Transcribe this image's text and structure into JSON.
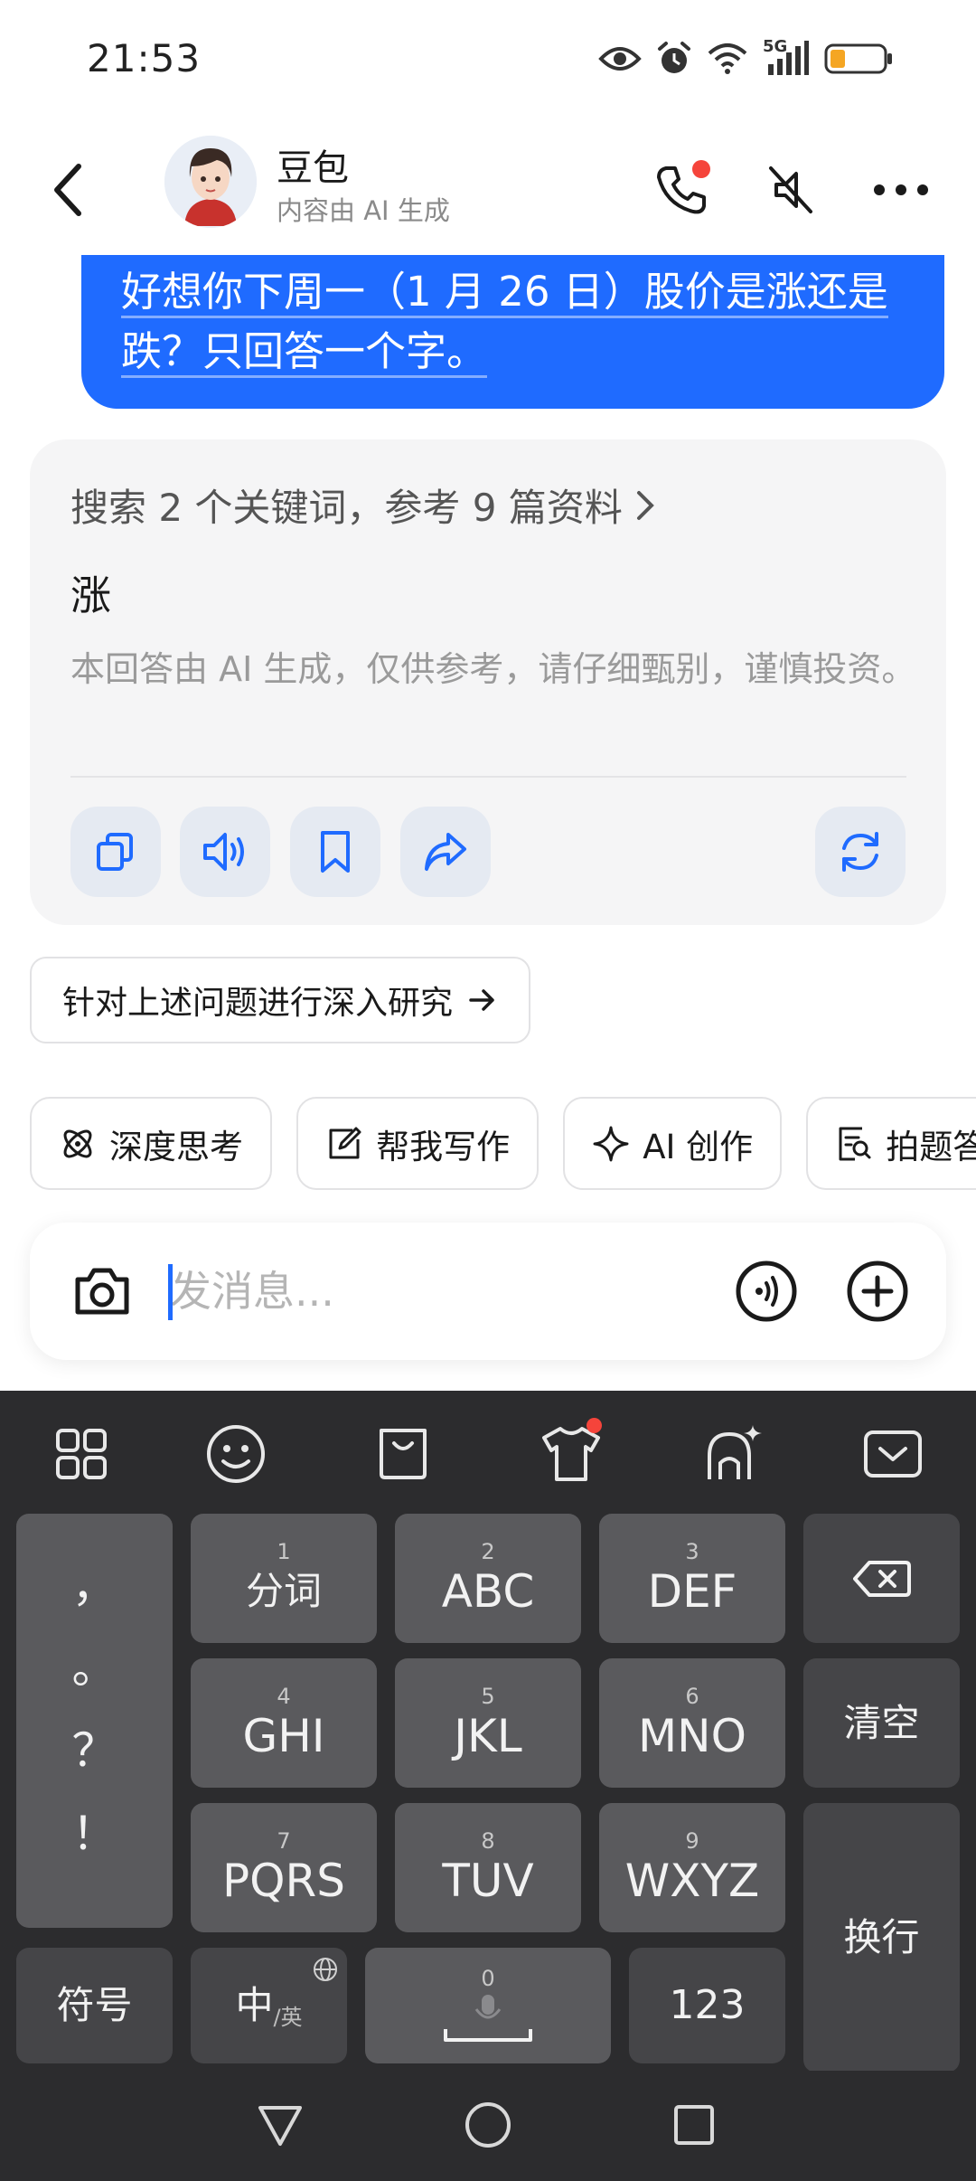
{
  "status_bar": {
    "time": "21:53",
    "network": "5G",
    "icons": [
      "eye-icon",
      "alarm-icon",
      "wifi-icon",
      "signal-icon",
      "battery-icon"
    ],
    "battery_color": "#f5a623"
  },
  "header": {
    "name": "豆包",
    "subtitle": "内容由 AI 生成",
    "icons": [
      "back-icon",
      "phone-icon",
      "mute-icon",
      "more-icon"
    ],
    "notification_color": "#f5443b"
  },
  "chat": {
    "user_message": {
      "line1": "好想你下周一（1 月 26 日）股价是涨还是",
      "line2": "跌？只回答一个字。"
    },
    "answer": {
      "search_summary": "搜索 2 个关键词，参考 9 篇资料",
      "text": "涨",
      "disclaimer": "本回答由 AI 生成，仅供参考，请仔细甄别，谨慎投资。",
      "actions": [
        "copy-icon",
        "speaker-icon",
        "bookmark-icon",
        "share-icon",
        "regenerate-icon"
      ]
    },
    "deep_research_label": "针对上述问题进行深入研究",
    "accent_color": "#1f6bff"
  },
  "chips": [
    {
      "label": "深度思考",
      "icon": "atom-icon"
    },
    {
      "label": "帮我写作",
      "icon": "edit-icon"
    },
    {
      "label": "AI 创作",
      "icon": "sparkle-icon"
    },
    {
      "label": "拍题答疑",
      "icon": "photo-search-icon"
    }
  ],
  "input": {
    "placeholder": "发消息...",
    "value": ""
  },
  "keyboard": {
    "toolbar": [
      "grid-icon",
      "emoji-icon",
      "clipboard-icon",
      "skin-icon",
      "ai-keyboard-icon",
      "collapse-icon"
    ],
    "punctuation": [
      "，",
      "。",
      "？",
      "！"
    ],
    "keys": [
      {
        "num": "1",
        "label": "分词"
      },
      {
        "num": "2",
        "label": "ABC"
      },
      {
        "num": "3",
        "label": "DEF"
      },
      {
        "num": "4",
        "label": "GHI"
      },
      {
        "num": "5",
        "label": "JKL"
      },
      {
        "num": "6",
        "label": "MNO"
      },
      {
        "num": "7",
        "label": "PQRS"
      },
      {
        "num": "8",
        "label": "TUV"
      },
      {
        "num": "9",
        "label": "WXYZ"
      }
    ],
    "clear": "清空",
    "enter": "换行",
    "symbols": "符号",
    "lang_main": "中",
    "lang_alt": "/英",
    "space_num": "0",
    "numbers": "123"
  },
  "nav": [
    "back-triangle-icon",
    "home-circle-icon",
    "recents-square-icon"
  ]
}
